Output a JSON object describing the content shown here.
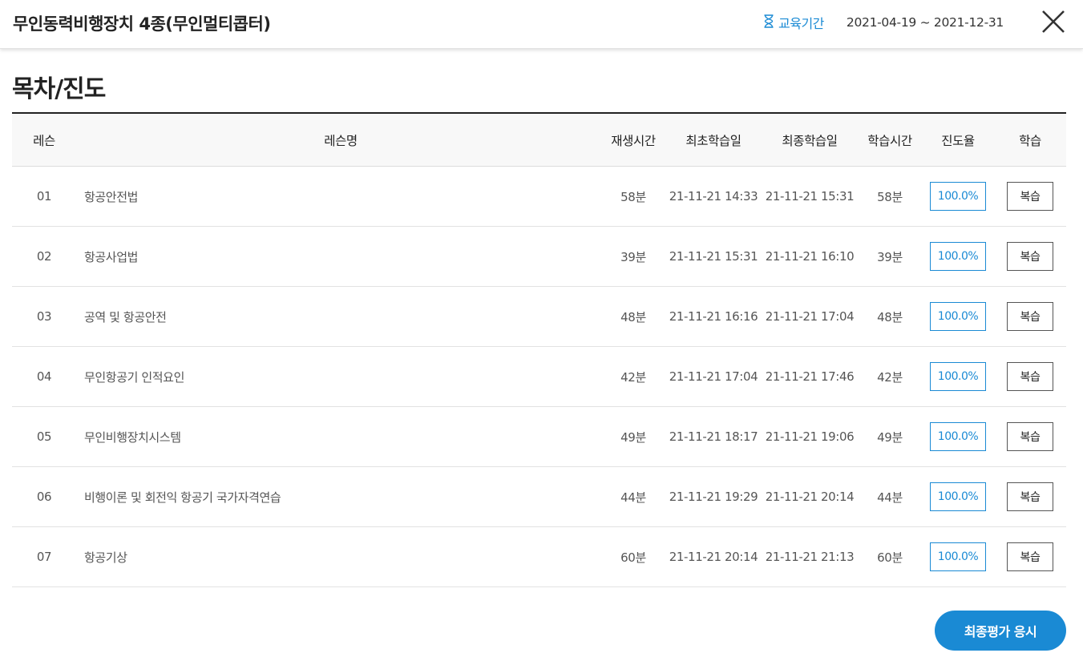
{
  "header": {
    "course_title": "무인동력비행장치 4종(무인멀티콥터)",
    "period_label": "교육기간",
    "period_range": "2021-04-19 ~ 2021-12-31",
    "period_icon": "hourglass-icon",
    "close_icon": "close-icon"
  },
  "section": {
    "title": "목차/진도"
  },
  "table": {
    "columns": {
      "no": "레슨",
      "name": "레슨명",
      "play_time": "재생시간",
      "first_date": "최초학습일",
      "last_date": "최종학습일",
      "study_time": "학습시간",
      "progress": "진도율",
      "study": "학습"
    },
    "rows": [
      {
        "no": "01",
        "name": "항공안전법",
        "play_time": "58분",
        "first_date": "21-11-21 14:33",
        "last_date": "21-11-21 15:31",
        "study_time": "58분",
        "progress": "100.0%",
        "action": "복습"
      },
      {
        "no": "02",
        "name": "항공사업법",
        "play_time": "39분",
        "first_date": "21-11-21 15:31",
        "last_date": "21-11-21 16:10",
        "study_time": "39분",
        "progress": "100.0%",
        "action": "복습"
      },
      {
        "no": "03",
        "name": "공역 및 항공안전",
        "play_time": "48분",
        "first_date": "21-11-21 16:16",
        "last_date": "21-11-21 17:04",
        "study_time": "48분",
        "progress": "100.0%",
        "action": "복습"
      },
      {
        "no": "04",
        "name": "무인항공기 인적요인",
        "play_time": "42분",
        "first_date": "21-11-21 17:04",
        "last_date": "21-11-21 17:46",
        "study_time": "42분",
        "progress": "100.0%",
        "action": "복습"
      },
      {
        "no": "05",
        "name": "무인비행장치시스템",
        "play_time": "49분",
        "first_date": "21-11-21 18:17",
        "last_date": "21-11-21 19:06",
        "study_time": "49분",
        "progress": "100.0%",
        "action": "복습"
      },
      {
        "no": "06",
        "name": "비행이론 및 회전익 항공기 국가자격연습",
        "play_time": "44분",
        "first_date": "21-11-21 19:29",
        "last_date": "21-11-21 20:14",
        "study_time": "44분",
        "progress": "100.0%",
        "action": "복습"
      },
      {
        "no": "07",
        "name": "항공기상",
        "play_time": "60분",
        "first_date": "21-11-21 20:14",
        "last_date": "21-11-21 21:13",
        "study_time": "60분",
        "progress": "100.0%",
        "action": "복습"
      }
    ]
  },
  "footer": {
    "final_exam_label": "최종평가 응시"
  },
  "colors": {
    "accent": "#1a8ad4",
    "text": "#333333",
    "header_bg": "#f8f8f8"
  }
}
